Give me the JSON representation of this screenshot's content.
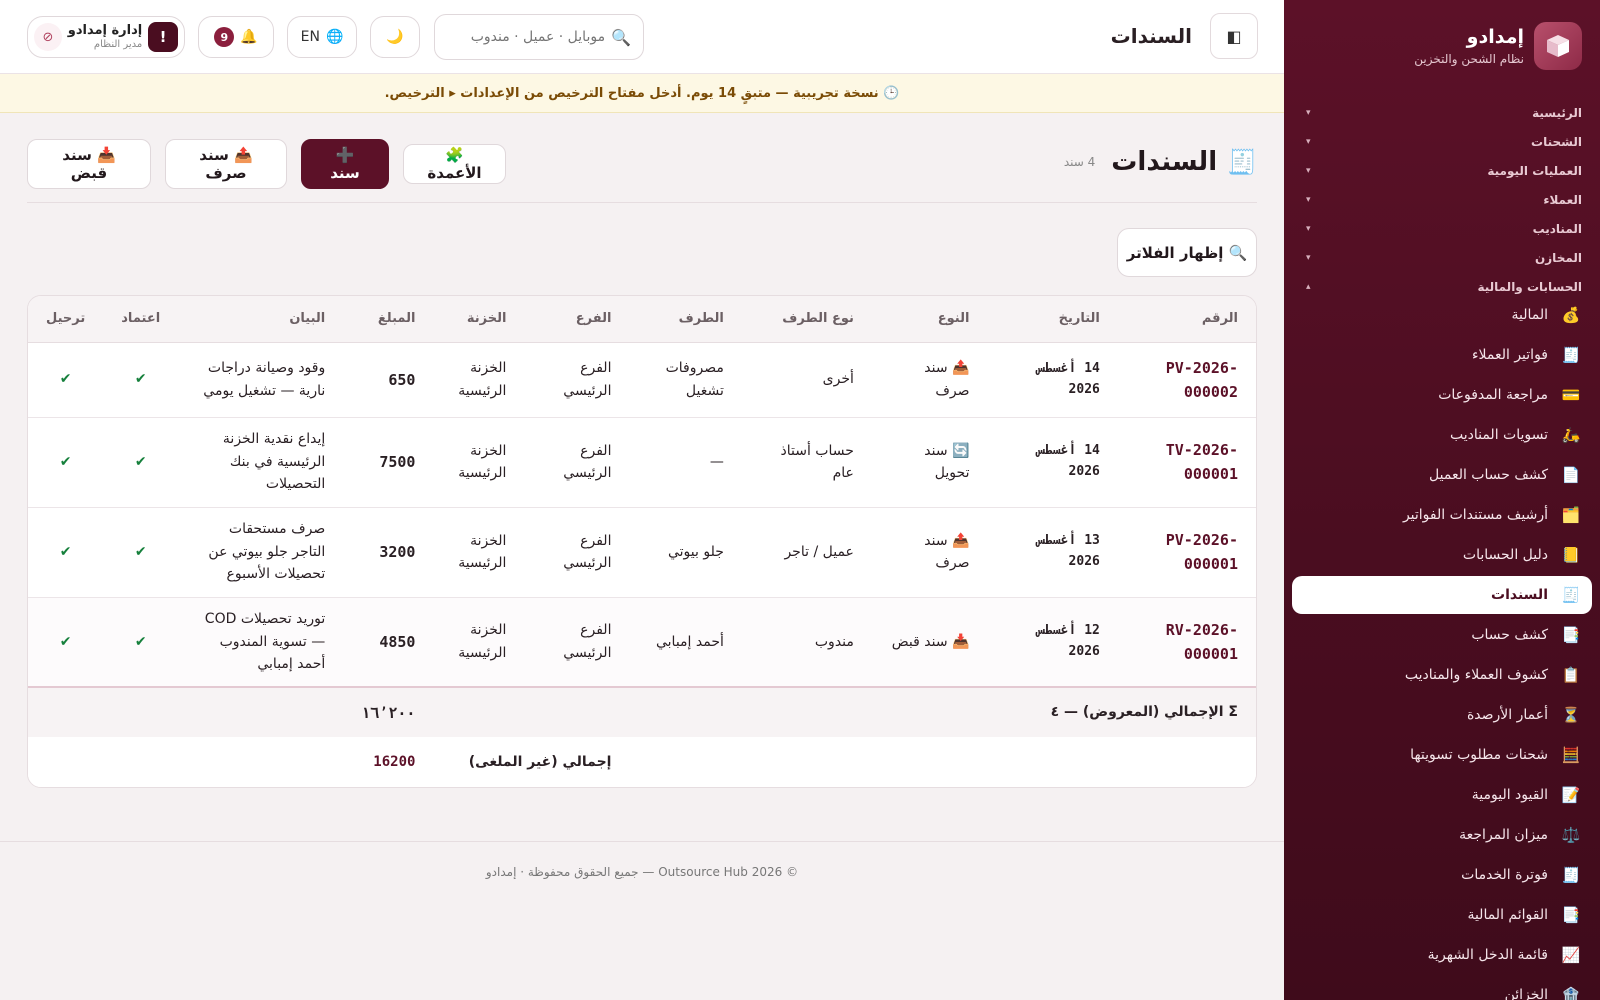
{
  "brand": {
    "name": "إمدادو",
    "subtitle": "نظام الشحن والتخزين"
  },
  "sidebar": {
    "groups": [
      {
        "label": "الرئيسية",
        "chevron": "▾"
      },
      {
        "label": "الشحنات",
        "chevron": "▾"
      },
      {
        "label": "العمليات اليومية",
        "chevron": "▾"
      },
      {
        "label": "العملاء",
        "chevron": "▾"
      },
      {
        "label": "المناديب",
        "chevron": "▾"
      },
      {
        "label": "المخازن",
        "chevron": "▾"
      },
      {
        "label": "الحسابات والمالية",
        "chevron": "▴"
      }
    ],
    "items": [
      {
        "label": "المالية",
        "icon": "💰"
      },
      {
        "label": "فواتير العملاء",
        "icon": "🧾"
      },
      {
        "label": "مراجعة المدفوعات",
        "icon": "💳"
      },
      {
        "label": "تسويات المناديب",
        "icon": "🛵"
      },
      {
        "label": "كشف حساب العميل",
        "icon": "📄"
      },
      {
        "label": "أرشيف مستندات الفواتير",
        "icon": "🗂️"
      },
      {
        "label": "دليل الحسابات",
        "icon": "📒"
      },
      {
        "label": "السندات",
        "icon": "🧾"
      },
      {
        "label": "كشف حساب",
        "icon": "📑"
      },
      {
        "label": "كشوف العملاء والمناديب",
        "icon": "📋"
      },
      {
        "label": "أعمار الأرصدة",
        "icon": "⏳"
      },
      {
        "label": "شحنات مطلوب تسويتها",
        "icon": "🧮"
      },
      {
        "label": "القيود اليومية",
        "icon": "📝"
      },
      {
        "label": "ميزان المراجعة",
        "icon": "⚖️"
      },
      {
        "label": "فوترة الخدمات",
        "icon": "🧾"
      },
      {
        "label": "القوائم المالية",
        "icon": "📑"
      },
      {
        "label": "قائمة الدخل الشهرية",
        "icon": "📈"
      },
      {
        "label": "الخزائن",
        "icon": "🏦"
      }
    ],
    "active_index": 7
  },
  "topbar": {
    "toggle_icon": "◧",
    "title": "السندات",
    "search_placeholder": "موبايل · عميل · مندوب",
    "search_icon": "🔍",
    "theme_icon": "🌙",
    "lang_icon": "🌐",
    "lang_label": "EN",
    "bell_icon": "🔔",
    "notif_count": "9",
    "user_name": "إدارة إمدادو",
    "user_role": "مدير النظام",
    "alert_glyph": "!",
    "logout_icon": "⦸"
  },
  "trial_banner": "🕒 نسخة تجريبية — متبقٍ 14 يوم. أدخل مفتاح الترخيص من الإعدادات ▸ الترخيص.",
  "page": {
    "icon": "🧾",
    "title": "السندات",
    "count": "4 سند",
    "buttons": {
      "receipt": "📥 سند قبض",
      "payment": "📤 سند صرف",
      "new": "➕ سند",
      "columns": "🧩 الأعمدة"
    },
    "filter_button": "🔍 إظهار الفلاتر"
  },
  "table": {
    "headers": [
      "الرقم",
      "التاريخ",
      "النوع",
      "نوع الطرف",
      "الطرف",
      "الفرع",
      "الخزنة",
      "المبلغ",
      "البيان",
      "اعتماد",
      "ترحيل"
    ],
    "rows": [
      {
        "num": "PV-2026-000002",
        "date": "14 أغسطس 2026",
        "type": "📤 سند صرف",
        "party_type": "أخرى",
        "party": "مصروفات تشغيل",
        "branch": "الفرع الرئيسي",
        "treasury": "الخزنة الرئيسية",
        "amount": "650",
        "desc": "وقود وصيانة دراجات نارية — تشغيل يومي",
        "approved": "✔",
        "posted": "✔"
      },
      {
        "num": "TV-2026-000001",
        "date": "14 أغسطس 2026",
        "type": "🔄 سند تحويل",
        "party_type": "حساب أستاذ عام",
        "party": "—",
        "branch": "الفرع الرئيسي",
        "treasury": "الخزنة الرئيسية",
        "amount": "7500",
        "desc": "إيداع نقدية الخزنة الرئيسية في بنك التحصيلات",
        "approved": "✔",
        "posted": "✔"
      },
      {
        "num": "PV-2026-000001",
        "date": "13 أغسطس 2026",
        "type": "📤 سند صرف",
        "party_type": "عميل / تاجر",
        "party": "جلو بيوتي",
        "branch": "الفرع الرئيسي",
        "treasury": "الخزنة الرئيسية",
        "amount": "3200",
        "desc": "صرف مستحقات التاجر جلو بيوتي عن تحصيلات الأسبوع",
        "approved": "✔",
        "posted": "✔"
      },
      {
        "num": "RV-2026-000001",
        "date": "12 أغسطس 2026",
        "type": "📥 سند قبض",
        "party_type": "مندوب",
        "party": "أحمد إمبابي",
        "branch": "الفرع الرئيسي",
        "treasury": "الخزنة الرئيسية",
        "amount": "4850",
        "desc": "توريد تحصيلات COD — تسوية المندوب أحمد إمبابي",
        "approved": "✔",
        "posted": "✔"
      }
    ],
    "total_shown_label": "Σ الإجمالي (المعروض) — ٤",
    "total_shown_value": "١٦٬٢٠٠",
    "total_active_label": "إجمالي (غير الملغى)",
    "total_active_value": "16200"
  },
  "footer": "© 2026 Outsource Hub — جميع الحقوق محفوظة · إمدادو",
  "colors": {
    "brand": "#5c1128",
    "sidebar": "#4a0d20",
    "accent_check": "#16803c",
    "trial_bg": "#fdf8e4"
  }
}
